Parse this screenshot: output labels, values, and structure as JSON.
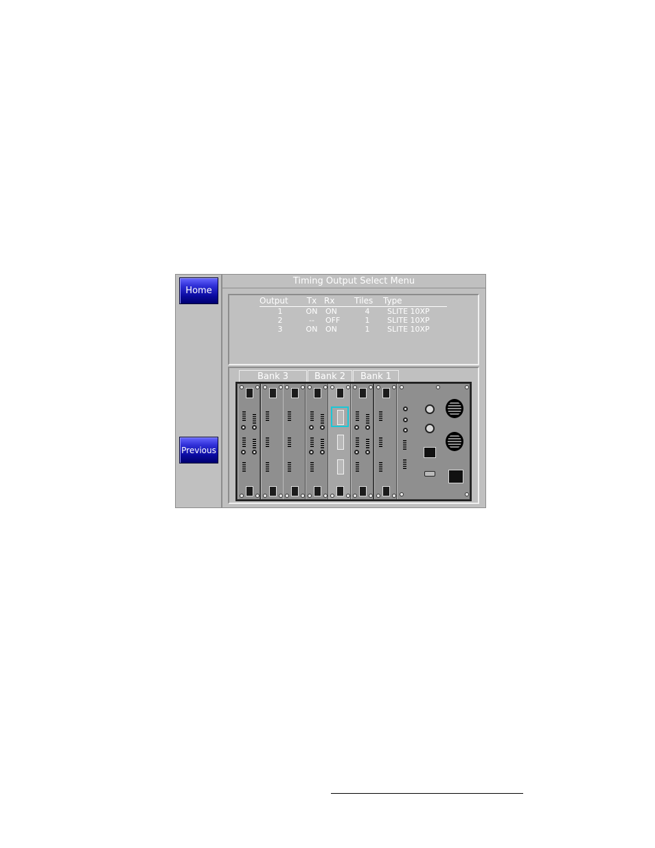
{
  "menu": {
    "title": "Timing Output Select Menu",
    "home_label": "Home",
    "previous_label": "Previous"
  },
  "table": {
    "headers": {
      "output": "Output",
      "tx": "Tx",
      "rx": "Rx",
      "tiles": "Tiles",
      "type": "Type"
    },
    "rows": [
      {
        "output": "1",
        "tx": "ON",
        "rx": "ON",
        "tiles": "4",
        "type": "SLITE 10XP"
      },
      {
        "output": "2",
        "tx": "--",
        "rx": "OFF",
        "tiles": "1",
        "type": "SLITE 10XP"
      },
      {
        "output": "3",
        "tx": "ON",
        "rx": "ON",
        "tiles": "1",
        "type": "SLITE 10XP"
      }
    ]
  },
  "rack": {
    "banks": [
      "Bank 3",
      "Bank 2",
      "Bank 1"
    ],
    "selected_bank": "Bank 2",
    "highlight_color": "#18c8d8"
  },
  "colors": {
    "nav_button": "#0a0aa0",
    "panel_bg": "#c0c0c0",
    "chassis": "#303030"
  }
}
